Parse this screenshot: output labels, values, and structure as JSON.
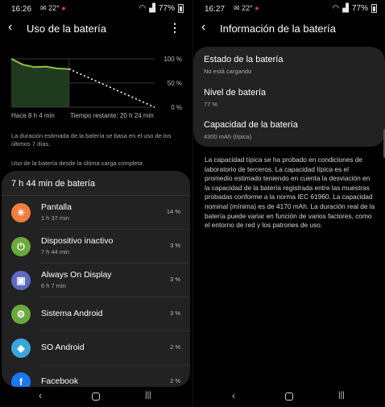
{
  "left": {
    "status": {
      "time": "16:26",
      "icons": "22°",
      "battery": "77%"
    },
    "title": "Uso de la batería",
    "chart_data": {
      "type": "line",
      "y_ticks": [
        "100 %",
        "50 %",
        "0 %"
      ],
      "ylim": [
        0,
        100
      ],
      "used_series": [
        [
          0,
          100
        ],
        [
          1,
          88
        ],
        [
          2,
          83
        ],
        [
          3,
          84
        ],
        [
          4,
          80
        ],
        [
          5,
          79
        ]
      ],
      "projection": [
        [
          5,
          79
        ],
        [
          12.4,
          0
        ]
      ],
      "x_label_left": "Hace 8 h 4 min",
      "x_label_right": "Tiempo restante: 20 h 24 min",
      "colors": {
        "line": "#8bc34a",
        "fill": "#203a1f",
        "projection": "#ffffff"
      }
    },
    "note": "La duración estimada de la batería se basa en el uso de los últimos 7 días.",
    "since_label": "Uso de la batería desde la última carga completa",
    "usage_header": "7 h 44 min de batería",
    "apps": [
      {
        "name": "Pantalla",
        "time": "1 h 37 min",
        "pct": "14 %",
        "icon": "sun-icon",
        "color": "#ef7d3c"
      },
      {
        "name": "Dispositivo inactivo",
        "time": "7 h 44 min",
        "pct": "3 %",
        "icon": "power-icon",
        "color": "#6aa93d"
      },
      {
        "name": "Always On Display",
        "time": "6 h 7 min",
        "pct": "3 %",
        "icon": "aod-icon",
        "color": "#5c6bc0"
      },
      {
        "name": "Sistema Android",
        "time": "",
        "pct": "3 %",
        "icon": "gear-icon",
        "color": "#6aa93d"
      },
      {
        "name": "SO Android",
        "time": "",
        "pct": "2 %",
        "icon": "android-icon",
        "color": "#3aa5dc"
      },
      {
        "name": "Facebook",
        "time": "",
        "pct": "2 %",
        "icon": "facebook-icon",
        "color": "#1877f2"
      }
    ]
  },
  "right": {
    "status": {
      "time": "16:27",
      "icons": "22°",
      "battery": "77%"
    },
    "title": "Información de la batería",
    "items": [
      {
        "label": "Estado de la batería",
        "value": "No está cargando"
      },
      {
        "label": "Nivel de batería",
        "value": "77 %"
      },
      {
        "label": "Capacidad de la batería",
        "value": "4300 mAh (típica)"
      }
    ],
    "paragraph": "La capacidad típica se ha probado en condiciones de laboratorio de terceros. La capacidad típica es el promedio estimado teniendo en cuenta la desviación en la capacidad de la batería registrada entre las muestras probadas conforme a la norma IEC 61960. La capacidad nominal (mínima) es de 4170 mAh. La duración real de la batería puede variar en función de varios factores, como el entorno de red y los patrones de uso."
  },
  "nav": {
    "back": "‹",
    "recents": "|||"
  }
}
